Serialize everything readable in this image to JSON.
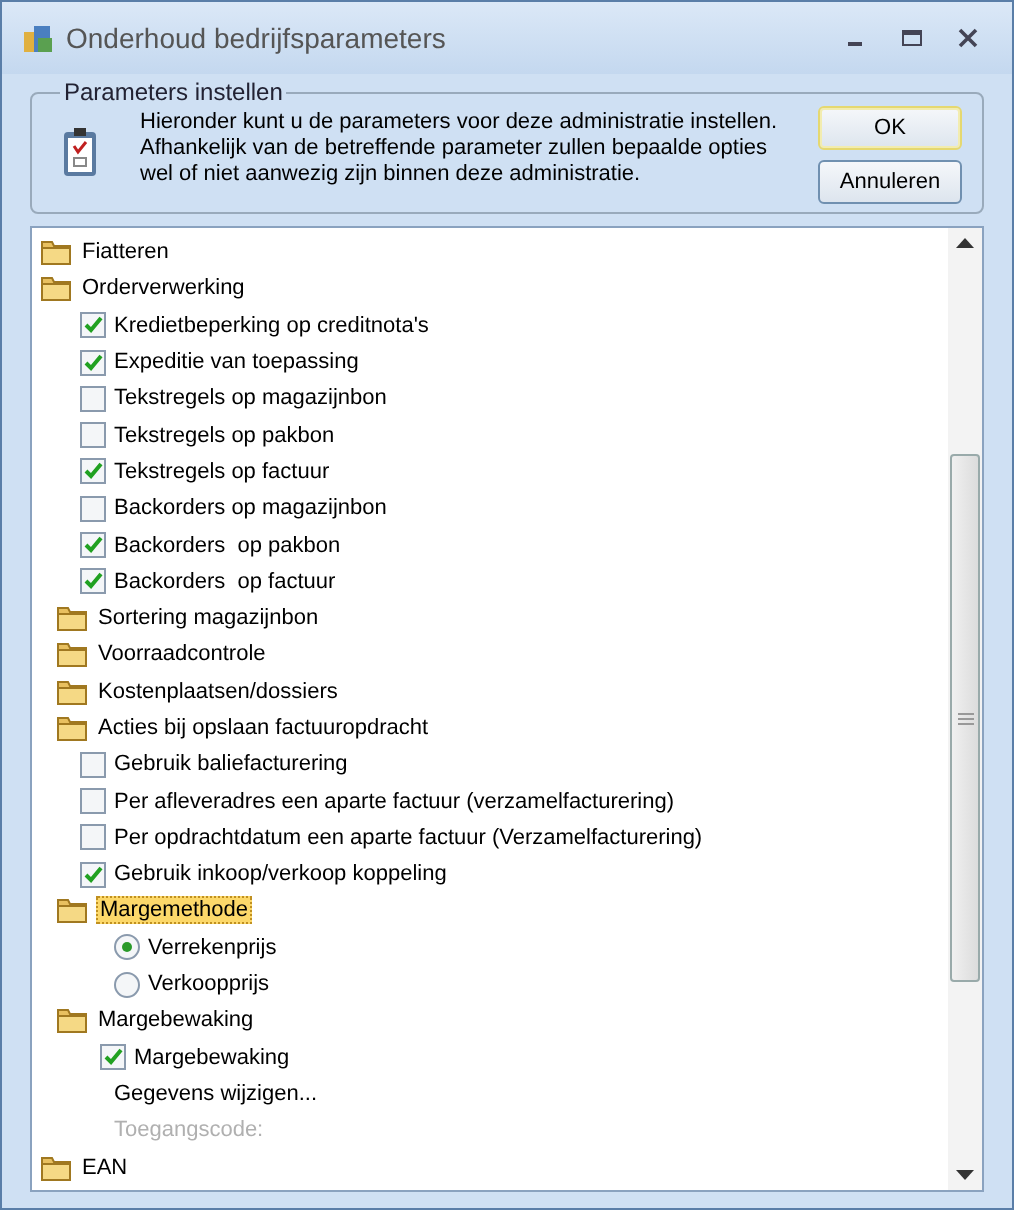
{
  "window": {
    "title": "Onderhoud bedrijfsparameters"
  },
  "group": {
    "title": "Parameters instellen",
    "description": "Hieronder kunt u de parameters voor deze administratie instellen. Afhankelijk van de betreffende parameter zullen bepaalde opties wel of niet aanwezig zijn binnen deze administratie."
  },
  "buttons": [
    {
      "label": "OK",
      "default": true
    },
    {
      "label": "Annuleren",
      "default": false
    }
  ],
  "tree": [
    {
      "label": "Fiatteren",
      "selected": false
    },
    {
      "label": "Orderverwerking",
      "selected": false,
      "children": [
        {
          "kind": "checkbox",
          "label": "Kredietbeperking op creditnota's",
          "checked": true
        },
        {
          "kind": "checkbox",
          "label": "Expeditie van toepassing",
          "checked": true
        },
        {
          "kind": "checkbox",
          "label": "Tekstregels op magazijnbon",
          "checked": false
        },
        {
          "kind": "checkbox",
          "label": "Tekstregels op pakbon",
          "checked": false
        },
        {
          "kind": "checkbox",
          "label": "Tekstregels op factuur",
          "checked": true
        },
        {
          "kind": "checkbox",
          "label": "Backorders op magazijnbon",
          "checked": false
        },
        {
          "kind": "checkbox",
          "label": "Backorders  op pakbon",
          "checked": true
        },
        {
          "kind": "checkbox",
          "label": "Backorders  op factuur",
          "checked": true
        }
      ]
    },
    {
      "label": "Sortering magazijnbon",
      "selected": false
    },
    {
      "label": "Voorraadcontrole",
      "selected": false
    },
    {
      "label": "Kostenplaatsen/dossiers",
      "selected": false
    },
    {
      "label": "Acties bij opslaan factuuropdracht",
      "selected": false,
      "children": [
        {
          "kind": "checkbox",
          "label": "Gebruik baliefacturering",
          "checked": false
        },
        {
          "kind": "checkbox",
          "label": "Per afleveradres een aparte factuur (verzamelfacturering)",
          "checked": false
        },
        {
          "kind": "checkbox",
          "label": "Per opdrachtdatum een aparte factuur (Verzamelfacturering)",
          "checked": false
        },
        {
          "kind": "checkbox",
          "label": "Gebruik inkoop/verkoop koppeling",
          "checked": true
        }
      ]
    },
    {
      "label": "Margemethode",
      "selected": true,
      "children": [
        {
          "kind": "radio",
          "label": "Verrekenprijs",
          "selected": true
        },
        {
          "kind": "radio",
          "label": "Verkoopprijs",
          "selected": false
        }
      ]
    },
    {
      "label": "Margebewaking",
      "selected": false,
      "children": [
        {
          "kind": "checkbox",
          "label": "Margebewaking",
          "checked": true
        },
        {
          "kind": "text",
          "label": "Gegevens wijzigen...",
          "disabled": false
        },
        {
          "kind": "text",
          "label": "Toegangscode:",
          "disabled": true
        }
      ]
    },
    {
      "label": "EAN",
      "selected": false
    }
  ]
}
